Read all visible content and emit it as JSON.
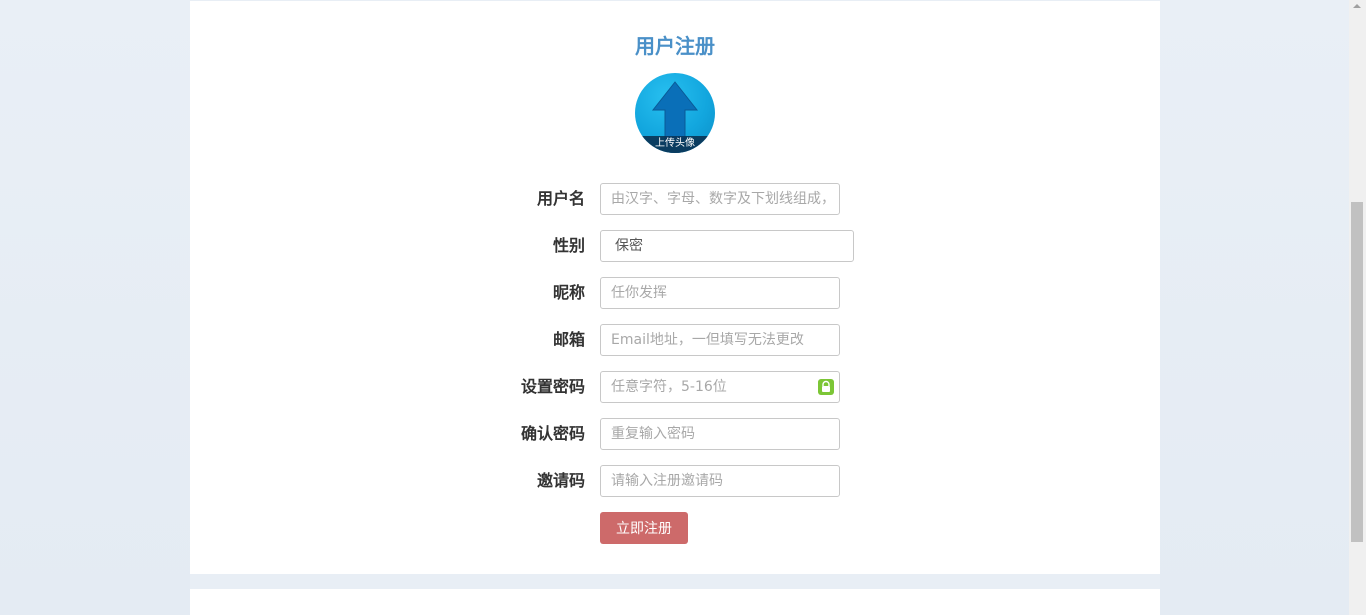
{
  "page": {
    "title": "用户注册"
  },
  "avatar": {
    "label": "上传头像",
    "icon": "upload-arrow-icon"
  },
  "form": {
    "username": {
      "label": "用户名",
      "placeholder": "由汉字、字母、数字及下划线组成，"
    },
    "gender": {
      "label": "性别",
      "value": "保密"
    },
    "nickname": {
      "label": "昵称",
      "placeholder": "任你发挥"
    },
    "email": {
      "label": "邮箱",
      "placeholder": "Email地址，一但填写无法更改"
    },
    "password": {
      "label": "设置密码",
      "placeholder": "任意字符，5-16位",
      "icon": "lock-icon"
    },
    "confirm_password": {
      "label": "确认密码",
      "placeholder": "重复输入密码"
    },
    "invite_code": {
      "label": "邀请码",
      "placeholder": "请输入注册邀请码"
    },
    "submit_label": "立即注册"
  },
  "colors": {
    "title": "#4a90c8",
    "submit_bg": "#cd6a6a",
    "lock_icon": "#7cc636",
    "background": "#e8eef5"
  }
}
